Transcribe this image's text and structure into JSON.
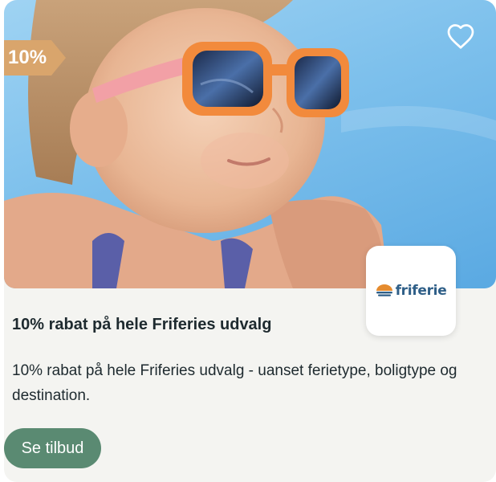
{
  "offer": {
    "discount_badge": "10%",
    "brand_logo_text": "friferie",
    "title": "10% rabat på hele Friferies udvalg",
    "description": "10% rabat på hele Friferies udvalg - uanset ferietype, boligtype og destination.",
    "cta_label": "Se tilbud"
  },
  "icons": {
    "favorite": "heart-outline-icon",
    "brand_mark": "sunrise-logo-icon"
  },
  "colors": {
    "card_background": "#f4f4f1",
    "badge": "#d9a56c",
    "cta_button": "#5a8a72",
    "brand_text": "#2f5f88",
    "text": "#1e2a2f"
  }
}
